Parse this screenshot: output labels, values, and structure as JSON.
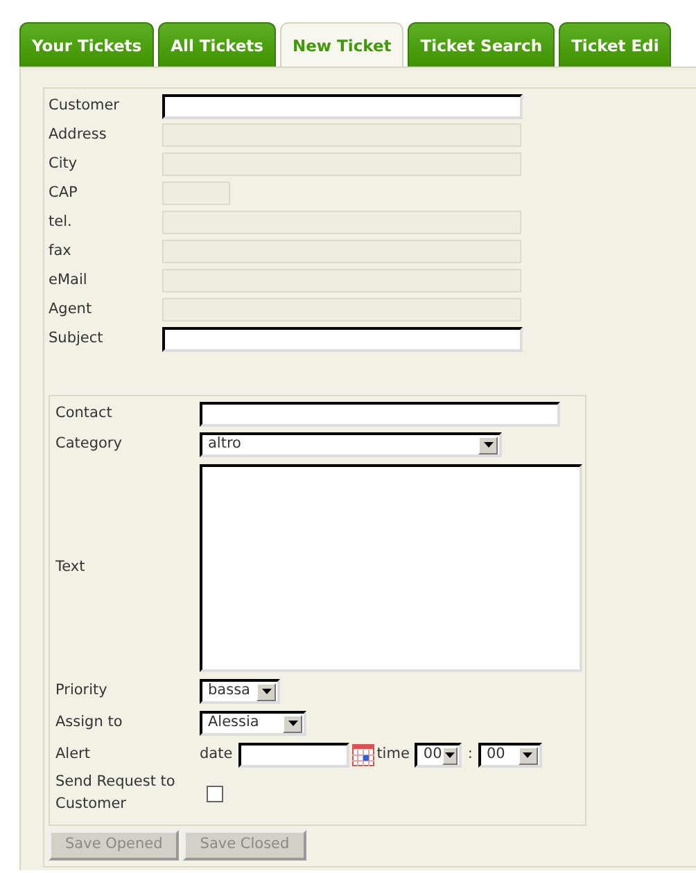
{
  "tabs": [
    {
      "label": "Your Tickets",
      "selected": false
    },
    {
      "label": "All Tickets",
      "selected": false
    },
    {
      "label": "New Ticket",
      "selected": true
    },
    {
      "label": "Ticket Search",
      "selected": false
    },
    {
      "label": "Ticket Edi",
      "selected": false
    }
  ],
  "customer_fields": [
    {
      "label": "Customer",
      "kind": "wide",
      "disabled": false
    },
    {
      "label": "Address",
      "kind": "wide",
      "disabled": true
    },
    {
      "label": "City",
      "kind": "wide",
      "disabled": true
    },
    {
      "label": "CAP",
      "kind": "short",
      "disabled": true
    },
    {
      "label": "tel.",
      "kind": "wide",
      "disabled": true
    },
    {
      "label": "fax",
      "kind": "wide",
      "disabled": true
    },
    {
      "label": "eMail",
      "kind": "wide",
      "disabled": true
    },
    {
      "label": "Agent",
      "kind": "wide",
      "disabled": true
    },
    {
      "label": "Subject",
      "kind": "wide",
      "disabled": false
    }
  ],
  "request": {
    "contact": {
      "label": "Contact"
    },
    "category": {
      "label": "Category",
      "value": "altro"
    },
    "text": {
      "label": "Text"
    },
    "priority": {
      "label": "Priority",
      "value": "bassa"
    },
    "assign_to": {
      "label": "Assign to",
      "value": "Alessia"
    },
    "alert": {
      "label": "Alert",
      "date_label": "date",
      "time_label": "time",
      "hour": "00",
      "separator": ":",
      "minute": "00"
    },
    "send_request": {
      "label": "Send Request to Customer",
      "checked": false
    }
  },
  "buttons": [
    {
      "label": "Save Opened",
      "disabled": true
    },
    {
      "label": "Save Closed",
      "disabled": true
    }
  ]
}
